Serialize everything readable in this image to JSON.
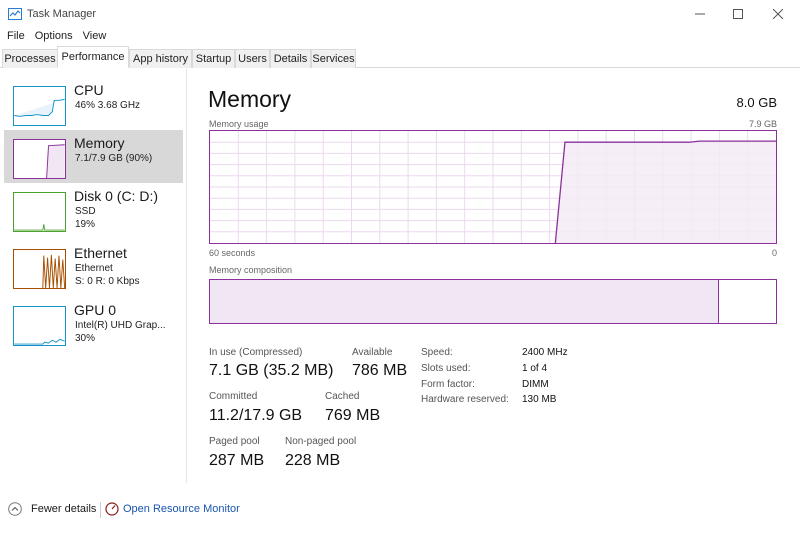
{
  "window": {
    "title": "Task Manager"
  },
  "menu": [
    "File",
    "Options",
    "View"
  ],
  "tabs": [
    "Processes",
    "Performance",
    "App history",
    "Startup",
    "Users",
    "Details",
    "Services"
  ],
  "active_tab": "Performance",
  "sidebar": [
    {
      "name": "CPU",
      "sub1": "46%  3.68 GHz",
      "sub2": "",
      "color": "#1791c9"
    },
    {
      "name": "Memory",
      "sub1": "7.1/7.9 GB (90%)",
      "sub2": "",
      "color": "#8b2f9c"
    },
    {
      "name": "Disk 0 (C: D:)",
      "sub1": "SSD",
      "sub2": "19%",
      "color": "#4da22f"
    },
    {
      "name": "Ethernet",
      "sub1": "Ethernet",
      "sub2": "S: 0 R: 0 Kbps",
      "color": "#a74f01"
    },
    {
      "name": "GPU 0",
      "sub1": "Intel(R) UHD Grap...",
      "sub2": "30%",
      "color": "#1791c9"
    }
  ],
  "main": {
    "title": "Memory",
    "total": "8.0 GB",
    "usage_label": "Memory usage",
    "usage_max": "7.9 GB",
    "axis_left": "60 seconds",
    "axis_right": "0",
    "composition_label": "Memory composition",
    "usage_history_fraction": [
      0,
      0,
      0,
      0,
      0,
      0,
      0,
      0,
      0,
      0,
      0,
      0,
      0,
      0,
      0,
      0,
      0,
      0,
      0,
      0,
      0,
      0,
      0,
      0,
      0,
      0,
      0,
      0,
      0,
      0,
      0,
      0,
      0,
      0,
      0,
      0,
      0,
      0.9,
      0.9,
      0.9,
      0.9,
      0.9,
      0.9,
      0.9,
      0.9,
      0.9,
      0.9,
      0.9,
      0.9,
      0.9,
      0.9,
      0.91,
      0.91,
      0.91,
      0.91,
      0.91,
      0.91,
      0.91,
      0.91,
      0.91
    ],
    "composition_in_use_fraction": 0.9,
    "stats": {
      "in_use_label": "In use (Compressed)",
      "in_use_value": "7.1 GB (35.2 MB)",
      "available_label": "Available",
      "available_value": "786 MB",
      "committed_label": "Committed",
      "committed_value": "11.2/17.9 GB",
      "cached_label": "Cached",
      "cached_value": "769 MB",
      "paged_label": "Paged pool",
      "paged_value": "287 MB",
      "nonpaged_label": "Non-paged pool",
      "nonpaged_value": "228 MB"
    },
    "specs": [
      {
        "label": "Speed:",
        "value": "2400 MHz"
      },
      {
        "label": "Slots used:",
        "value": "1 of 4"
      },
      {
        "label": "Form factor:",
        "value": "DIMM"
      },
      {
        "label": "Hardware reserved:",
        "value": "130 MB"
      }
    ]
  },
  "footer": {
    "fewer_details": "Fewer details",
    "open_resource_monitor": "Open Resource Monitor"
  }
}
